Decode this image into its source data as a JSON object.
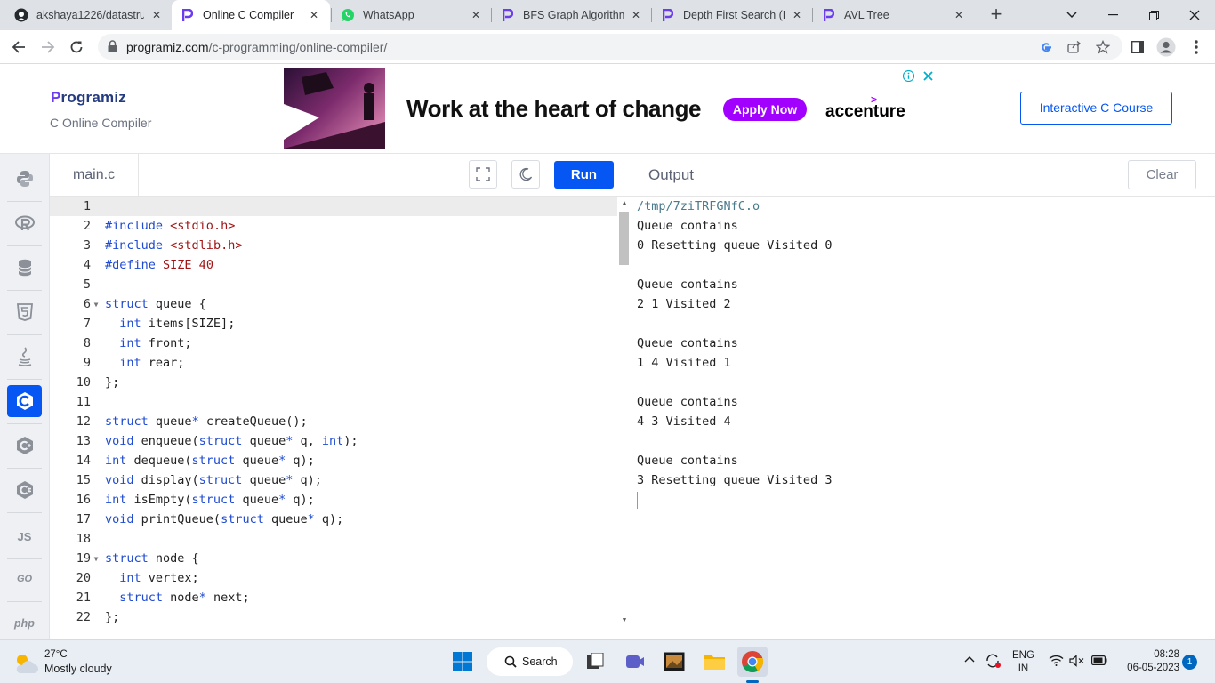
{
  "browser": {
    "tabs": [
      {
        "title": "akshaya1226/datastru",
        "icon": "github-icon"
      },
      {
        "title": "Online C Compiler",
        "icon": "programiz-icon",
        "active": true
      },
      {
        "title": "WhatsApp",
        "icon": "whatsapp-icon"
      },
      {
        "title": "BFS Graph Algorithm(",
        "icon": "programiz-icon"
      },
      {
        "title": "Depth First Search (DF",
        "icon": "programiz-icon"
      },
      {
        "title": "AVL Tree",
        "icon": "programiz-icon"
      }
    ],
    "url_host": "programiz.com",
    "url_path": "/c-programming/online-compiler/"
  },
  "header": {
    "logo_text": "rogramiz",
    "subtitle": "C Online Compiler",
    "ad_headline": "Work at the heart of change",
    "ad_button": "Apply Now",
    "ad_brand": "accenture",
    "course_button": "Interactive C Course"
  },
  "sidebar": {
    "languages": [
      {
        "name": "python-icon",
        "label": ""
      },
      {
        "name": "r-icon",
        "label": ""
      },
      {
        "name": "sql-icon",
        "label": ""
      },
      {
        "name": "html-icon",
        "label": ""
      },
      {
        "name": "java-icon",
        "label": ""
      },
      {
        "name": "c-icon",
        "label": "",
        "active": true
      },
      {
        "name": "cpp-icon",
        "label": ""
      },
      {
        "name": "csharp-icon",
        "label": ""
      },
      {
        "name": "js-icon",
        "label": "JS"
      },
      {
        "name": "go-icon",
        "label": "GO"
      },
      {
        "name": "php-icon",
        "label": "php"
      }
    ]
  },
  "editor": {
    "filename": "main.c",
    "run_label": "Run",
    "lines": [
      "",
      "#include <stdio.h>",
      "#include <stdlib.h>",
      "#define SIZE 40",
      "",
      "struct queue {",
      "  int items[SIZE];",
      "  int front;",
      "  int rear;",
      "};",
      "",
      "struct queue* createQueue();",
      "void enqueue(struct queue* q, int);",
      "int dequeue(struct queue* q);",
      "void display(struct queue* q);",
      "int isEmpty(struct queue* q);",
      "void printQueue(struct queue* q);",
      "",
      "struct node {",
      "  int vertex;",
      "  struct node* next;",
      "};"
    ],
    "fold_lines": [
      6,
      19
    ]
  },
  "output": {
    "title": "Output",
    "clear_label": "Clear",
    "lines": [
      "/tmp/7ziTRFGNfC.o",
      "Queue contains",
      "0 Resetting queue Visited 0",
      "",
      "Queue contains",
      "2 1 Visited 2",
      "",
      "Queue contains",
      "1 4 Visited 1",
      "",
      "Queue contains",
      "4 3 Visited 4",
      "",
      "Queue contains",
      "3 Resetting queue Visited 3"
    ]
  },
  "taskbar": {
    "temperature": "27°C",
    "weather": "Mostly cloudy",
    "search_label": "Search",
    "lang_top": "ENG",
    "lang_bottom": "IN",
    "time": "08:28",
    "date": "06-05-2023",
    "notifications": "1"
  },
  "colors": {
    "accent": "#0556f3",
    "ad_purple": "#a100ff"
  }
}
